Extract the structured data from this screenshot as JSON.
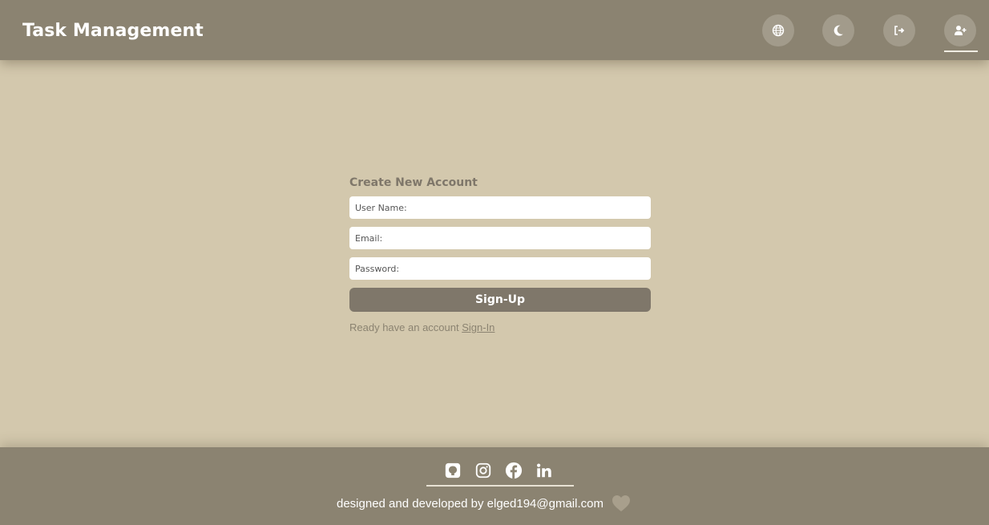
{
  "header": {
    "title": "Task Management",
    "icons": [
      "globe-icon",
      "moon-icon",
      "logout-icon",
      "add-user-icon"
    ]
  },
  "form": {
    "title": "Create New Account",
    "username_placeholder": "User Name:",
    "email_placeholder": "Email:",
    "password_placeholder": "Password:",
    "submit_label": "Sign-Up",
    "switch_text": "Ready have an account ",
    "switch_link": "Sign-In"
  },
  "footer": {
    "social": [
      "github-icon",
      "instagram-icon",
      "facebook-icon",
      "linkedin-icon"
    ],
    "credit": "designed and developed by elged194@gmail.com"
  },
  "colors": {
    "header_bg": "#8b8371",
    "page_bg": "#d3c8ad",
    "button_bg": "#7f776a",
    "nav_button_bg": "#a29b8b"
  }
}
